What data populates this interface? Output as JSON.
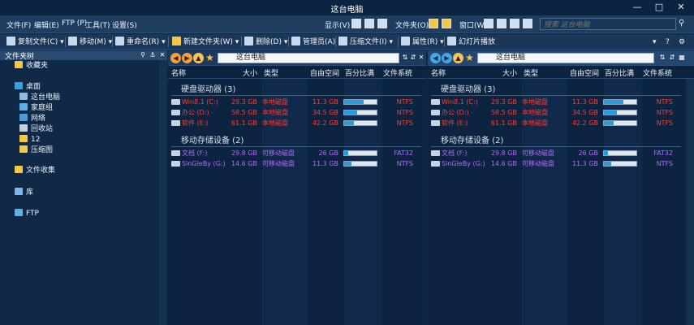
{
  "window": {
    "title": "这台电脑"
  },
  "menubar": {
    "items": [
      "文件(F)",
      "编辑(E)",
      "FTP (P)",
      "工具(T)",
      "设置(S)"
    ],
    "right": [
      "显示(V)",
      "文件夹(O)",
      "窗口(W)"
    ],
    "search_placeholder": "搜索 这台电脑"
  },
  "toolbar": {
    "buttons": [
      "复制文件(C)",
      "移动(M)",
      "重命名(R)",
      "新建文件夹(W)",
      "删除(D)",
      "管理员(A)",
      "压缩文件(I)",
      "属性(R)",
      "幻灯片播放"
    ]
  },
  "tree": {
    "header": "文件夹树",
    "items": [
      "收藏夹",
      "桌面",
      "这台电脑",
      "家庭组",
      "网络",
      "回收站",
      "12",
      "压缩图",
      "文件收集",
      "库",
      "FTP"
    ]
  },
  "colors": {
    "accent": "#2a9ad8",
    "red": "#ff3b30",
    "purple": "#b06cff",
    "bg": "#0d2440"
  },
  "panes": [
    {
      "address": "这台电脑",
      "columns": [
        "名称",
        "大小",
        "类型",
        "自由空间",
        "百分比满",
        "文件系统"
      ],
      "groups": [
        {
          "title": "硬盘驱动器 (3)",
          "drives": [
            {
              "name": "Win8.1 (C:)",
              "size": "29.3 GB",
              "type": "本地磁盘",
              "free": "11.3 GB",
              "pct_full": 61,
              "fs": "NTFS",
              "color": "red"
            },
            {
              "name": "办公 (D:)",
              "size": "58.5 GB",
              "type": "本地磁盘",
              "free": "34.5 GB",
              "pct_full": 41,
              "fs": "NTFS",
              "color": "red"
            },
            {
              "name": "软件 (E:)",
              "size": "61.1 GB",
              "type": "本地磁盘",
              "free": "42.2 GB",
              "pct_full": 31,
              "fs": "NTFS",
              "color": "red"
            }
          ]
        },
        {
          "title": "移动存储设备 (2)",
          "drives": [
            {
              "name": "文档 (F:)",
              "size": "29.8 GB",
              "type": "可移动磁盘",
              "free": "26 GB",
              "pct_full": 13,
              "fs": "FAT32",
              "color": "purple"
            },
            {
              "name": "SinGleBy (G:)",
              "size": "14.6 GB",
              "type": "可移动磁盘",
              "free": "11.3 GB",
              "pct_full": 23,
              "fs": "NTFS",
              "color": "purple"
            }
          ]
        }
      ]
    },
    {
      "address": "这台电脑",
      "columns": [
        "名称",
        "大小",
        "类型",
        "自由空间",
        "百分比满",
        "文件系统"
      ],
      "groups": [
        {
          "title": "硬盘驱动器 (3)",
          "drives": [
            {
              "name": "Win8.1 (C:)",
              "size": "29.3 GB",
              "type": "本地磁盘",
              "free": "11.3 GB",
              "pct_full": 61,
              "fs": "NTFS",
              "color": "red"
            },
            {
              "name": "办公 (D:)",
              "size": "58.5 GB",
              "type": "本地磁盘",
              "free": "34.5 GB",
              "pct_full": 41,
              "fs": "NTFS",
              "color": "red"
            },
            {
              "name": "软件 (E:)",
              "size": "61.1 GB",
              "type": "本地磁盘",
              "free": "42.2 GB",
              "pct_full": 31,
              "fs": "NTFS",
              "color": "red"
            }
          ]
        },
        {
          "title": "移动存储设备 (2)",
          "drives": [
            {
              "name": "文档 (F:)",
              "size": "29.8 GB",
              "type": "可移动磁盘",
              "free": "26 GB",
              "pct_full": 13,
              "fs": "FAT32",
              "color": "purple"
            },
            {
              "name": "SinGleBy (G:)",
              "size": "14.6 GB",
              "type": "可移动磁盘",
              "free": "11.3 GB",
              "pct_full": 23,
              "fs": "NTFS",
              "color": "purple"
            }
          ]
        }
      ]
    }
  ]
}
